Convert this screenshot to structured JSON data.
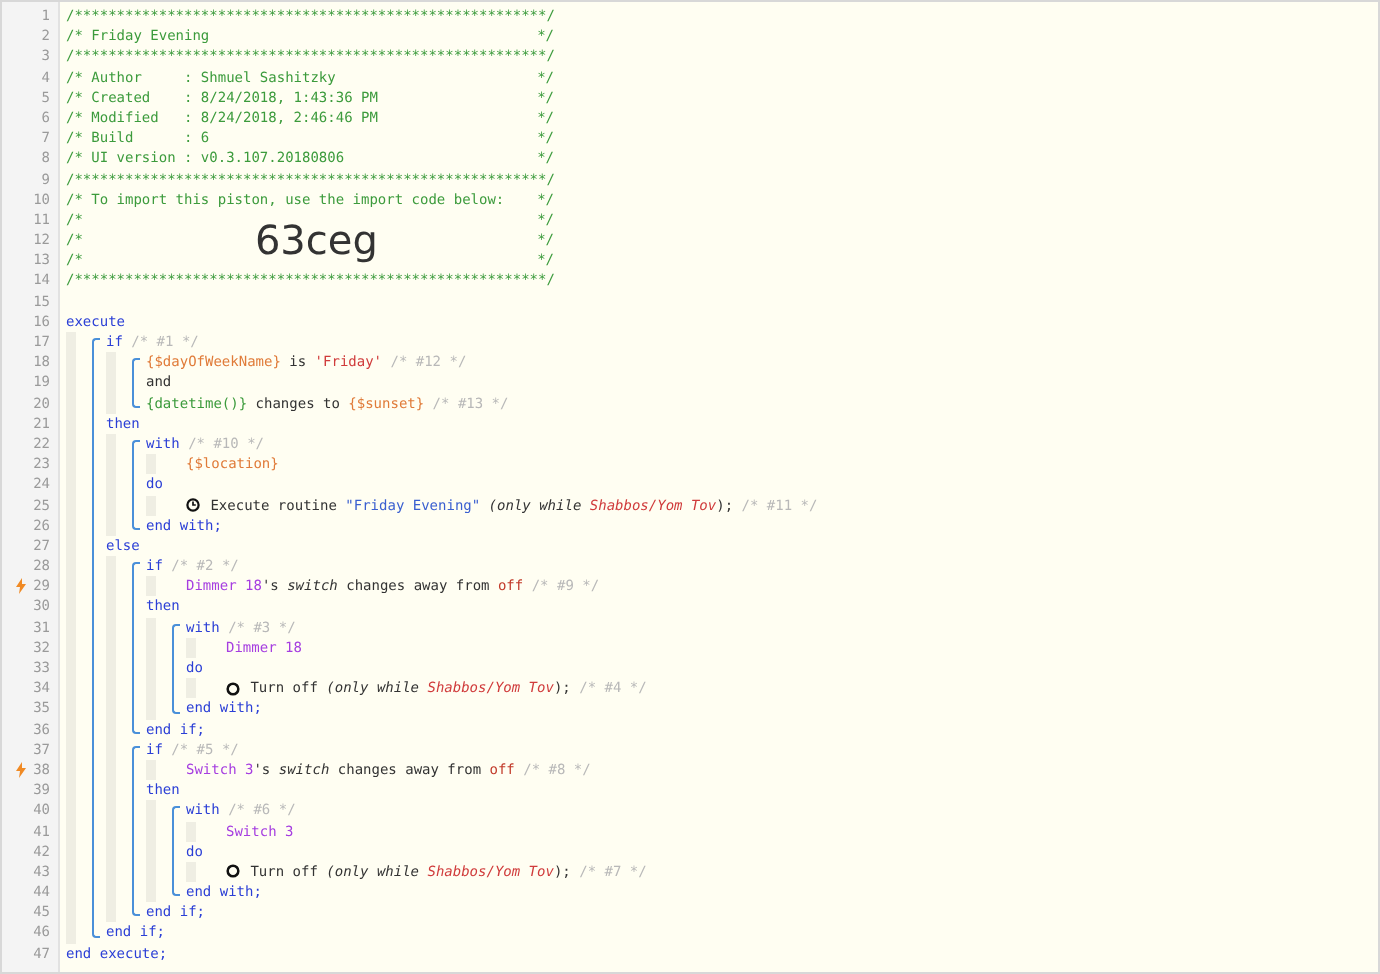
{
  "listing": [
    {
      "kind": "rule",
      "number": "1",
      "text": "/********************************************************/"
    },
    {
      "kind": "banner",
      "number": "2",
      "text": "/* Friday Evening",
      "end": "*/"
    },
    {
      "kind": "rule",
      "number": "3",
      "text": "/********************************************************/"
    },
    {
      "kind": "banner",
      "number": "4",
      "text": "/* Author     : Shmuel Sashitzky",
      "end": "*/"
    },
    {
      "kind": "banner",
      "number": "5",
      "text": "/* Created    : 8/24/2018, 1:43:36 PM",
      "end": "*/"
    },
    {
      "kind": "banner",
      "number": "6",
      "text": "/* Modified   : 8/24/2018, 2:46:46 PM",
      "end": "*/"
    },
    {
      "kind": "banner",
      "number": "7",
      "text": "/* Build      : 6",
      "end": "*/"
    },
    {
      "kind": "banner",
      "number": "8",
      "text": "/* UI version : v0.3.107.20180806",
      "end": "*/"
    },
    {
      "kind": "rule",
      "number": "9",
      "text": "/********************************************************/"
    },
    {
      "kind": "banner",
      "number": "10",
      "text": "/* To import this piston, use the import code below:",
      "end": "*/"
    },
    {
      "kind": "banner",
      "number": "11",
      "text": "/*",
      "end": "*/"
    },
    {
      "kind": "banner",
      "number": "12",
      "text": "/*",
      "end": "*/",
      "code": "63ceg"
    },
    {
      "kind": "banner",
      "number": "13",
      "text": "/*",
      "end": "*/"
    },
    {
      "kind": "rule",
      "number": "14",
      "text": "/********************************************************/"
    },
    {
      "kind": "blank",
      "number": "15"
    },
    {
      "kind": "code",
      "number": "16",
      "segments": [
        {
          "kind": "keyword",
          "text": "execute"
        }
      ],
      "children": [
        {
          "kind": "block",
          "children": [
            {
              "kind": "code",
              "number": "17",
              "segments": [
                {
                  "kind": "keyword",
                  "text": "if"
                },
                {
                  "kind": "note",
                  "text": " /* #1 */"
                }
              ],
              "children": [
                {
                  "kind": "block",
                  "children": [
                    {
                      "kind": "code",
                      "number": "18",
                      "segments": [
                        {
                          "kind": "variable",
                          "text": "{$dayOfWeekName}"
                        },
                        {
                          "kind": "text",
                          "text": " is "
                        },
                        {
                          "kind": "string",
                          "text": "'Friday'"
                        },
                        {
                          "kind": "note",
                          "text": " /* #12 */"
                        }
                      ]
                    },
                    {
                      "kind": "code",
                      "number": "19",
                      "segments": [
                        {
                          "kind": "text",
                          "text": "and"
                        }
                      ]
                    },
                    {
                      "kind": "code",
                      "number": "20",
                      "segments": [
                        {
                          "kind": "func",
                          "text": "{datetime()}"
                        },
                        {
                          "kind": "text",
                          "text": " changes to "
                        },
                        {
                          "kind": "variable",
                          "text": "{$sunset}"
                        },
                        {
                          "kind": "note",
                          "text": " /* #13 */"
                        }
                      ]
                    }
                  ]
                }
              ]
            },
            {
              "kind": "code",
              "number": "21",
              "segments": [
                {
                  "kind": "keyword",
                  "text": "then"
                }
              ],
              "children": [
                {
                  "kind": "block",
                  "children": [
                    {
                      "kind": "code",
                      "number": "22",
                      "segments": [
                        {
                          "kind": "keyword",
                          "text": "with"
                        },
                        {
                          "kind": "note",
                          "text": " /* #10 */"
                        }
                      ],
                      "children": [
                        {
                          "kind": "code",
                          "number": "23",
                          "segments": [
                            {
                              "kind": "variable",
                              "text": "{$location}"
                            }
                          ]
                        }
                      ]
                    },
                    {
                      "kind": "code",
                      "number": "24",
                      "segments": [
                        {
                          "kind": "keyword",
                          "text": "do"
                        }
                      ],
                      "children": [
                        {
                          "kind": "code",
                          "number": "25",
                          "segments": [
                            {
                              "kind": "clock"
                            },
                            {
                              "kind": "text",
                              "text": " Execute routine "
                            },
                            {
                              "kind": "literal",
                              "text": "\"Friday Evening\""
                            },
                            {
                              "kind": "italic",
                              "text": " (only while "
                            },
                            {
                              "kind": "condition",
                              "text": "Shabbos/Yom Tov"
                            },
                            {
                              "kind": "text",
                              "text": "); "
                            },
                            {
                              "kind": "note",
                              "text": "/* #11 */"
                            }
                          ]
                        }
                      ]
                    },
                    {
                      "kind": "code",
                      "number": "26",
                      "segments": [
                        {
                          "kind": "keyword",
                          "text": "end with;"
                        }
                      ]
                    }
                  ]
                }
              ]
            },
            {
              "kind": "code",
              "number": "27",
              "segments": [
                {
                  "kind": "keyword",
                  "text": "else"
                }
              ],
              "children": [
                {
                  "kind": "block",
                  "children": [
                    {
                      "kind": "code",
                      "number": "28",
                      "segments": [
                        {
                          "kind": "keyword",
                          "text": "if"
                        },
                        {
                          "kind": "note",
                          "text": " /* #2 */"
                        }
                      ],
                      "children": [
                        {
                          "kind": "code",
                          "number": "29",
                          "trigger": true,
                          "segments": [
                            {
                              "kind": "device",
                              "text": "Dimmer 18"
                            },
                            {
                              "kind": "text",
                              "text": "'s "
                            },
                            {
                              "kind": "italic",
                              "text": "switch"
                            },
                            {
                              "kind": "text",
                              "text": " changes away from "
                            },
                            {
                              "kind": "value",
                              "text": "off"
                            },
                            {
                              "kind": "note",
                              "text": " /* #9 */"
                            }
                          ]
                        }
                      ]
                    },
                    {
                      "kind": "code",
                      "number": "30",
                      "segments": [
                        {
                          "kind": "keyword",
                          "text": "then"
                        }
                      ],
                      "children": [
                        {
                          "kind": "block",
                          "children": [
                            {
                              "kind": "code",
                              "number": "31",
                              "segments": [
                                {
                                  "kind": "keyword",
                                  "text": "with"
                                },
                                {
                                  "kind": "note",
                                  "text": " /* #3 */"
                                }
                              ],
                              "children": [
                                {
                                  "kind": "code",
                                  "number": "32",
                                  "segments": [
                                    {
                                      "kind": "device",
                                      "text": "Dimmer 18"
                                    }
                                  ]
                                }
                              ]
                            },
                            {
                              "kind": "code",
                              "number": "33",
                              "segments": [
                                {
                                  "kind": "keyword",
                                  "text": "do"
                                }
                              ],
                              "children": [
                                {
                                  "kind": "code",
                                  "number": "34",
                                  "segments": [
                                    {
                                      "kind": "ring"
                                    },
                                    {
                                      "kind": "text",
                                      "text": " Turn off "
                                    },
                                    {
                                      "kind": "italic",
                                      "text": "(only while "
                                    },
                                    {
                                      "kind": "condition",
                                      "text": "Shabbos/Yom Tov"
                                    },
                                    {
                                      "kind": "text",
                                      "text": "); "
                                    },
                                    {
                                      "kind": "note",
                                      "text": "/* #4 */"
                                    }
                                  ]
                                }
                              ]
                            },
                            {
                              "kind": "code",
                              "number": "35",
                              "segments": [
                                {
                                  "kind": "keyword",
                                  "text": "end with;"
                                }
                              ]
                            }
                          ]
                        }
                      ]
                    },
                    {
                      "kind": "code",
                      "number": "36",
                      "segments": [
                        {
                          "kind": "keyword",
                          "text": "end if;"
                        }
                      ]
                    }
                  ]
                },
                {
                  "kind": "block",
                  "children": [
                    {
                      "kind": "code",
                      "number": "37",
                      "segments": [
                        {
                          "kind": "keyword",
                          "text": "if"
                        },
                        {
                          "kind": "note",
                          "text": " /* #5 */"
                        }
                      ],
                      "children": [
                        {
                          "kind": "code",
                          "number": "38",
                          "trigger": true,
                          "segments": [
                            {
                              "kind": "device",
                              "text": "Switch 3"
                            },
                            {
                              "kind": "text",
                              "text": "'s "
                            },
                            {
                              "kind": "italic",
                              "text": "switch"
                            },
                            {
                              "kind": "text",
                              "text": " changes away from "
                            },
                            {
                              "kind": "value",
                              "text": "off"
                            },
                            {
                              "kind": "note",
                              "text": " /* #8 */"
                            }
                          ]
                        }
                      ]
                    },
                    {
                      "kind": "code",
                      "number": "39",
                      "segments": [
                        {
                          "kind": "keyword",
                          "text": "then"
                        }
                      ],
                      "children": [
                        {
                          "kind": "block",
                          "children": [
                            {
                              "kind": "code",
                              "number": "40",
                              "segments": [
                                {
                                  "kind": "keyword",
                                  "text": "with"
                                },
                                {
                                  "kind": "note",
                                  "text": " /* #6 */"
                                }
                              ],
                              "children": [
                                {
                                  "kind": "code",
                                  "number": "41",
                                  "segments": [
                                    {
                                      "kind": "device",
                                      "text": "Switch 3"
                                    }
                                  ]
                                }
                              ]
                            },
                            {
                              "kind": "code",
                              "number": "42",
                              "segments": [
                                {
                                  "kind": "keyword",
                                  "text": "do"
                                }
                              ],
                              "children": [
                                {
                                  "kind": "code",
                                  "number": "43",
                                  "segments": [
                                    {
                                      "kind": "ring"
                                    },
                                    {
                                      "kind": "text",
                                      "text": " Turn off "
                                    },
                                    {
                                      "kind": "italic",
                                      "text": "(only while "
                                    },
                                    {
                                      "kind": "condition",
                                      "text": "Shabbos/Yom Tov"
                                    },
                                    {
                                      "kind": "text",
                                      "text": "); "
                                    },
                                    {
                                      "kind": "note",
                                      "text": "/* #7 */"
                                    }
                                  ]
                                }
                              ]
                            },
                            {
                              "kind": "code",
                              "number": "44",
                              "segments": [
                                {
                                  "kind": "keyword",
                                  "text": "end with;"
                                }
                              ]
                            }
                          ]
                        }
                      ]
                    },
                    {
                      "kind": "code",
                      "number": "45",
                      "segments": [
                        {
                          "kind": "keyword",
                          "text": "end if;"
                        }
                      ]
                    }
                  ]
                }
              ]
            },
            {
              "kind": "code",
              "number": "46",
              "segments": [
                {
                  "kind": "keyword",
                  "text": "end if;"
                }
              ]
            }
          ]
        }
      ]
    },
    {
      "kind": "code",
      "number": "47",
      "segments": [
        {
          "kind": "keyword",
          "text": "end execute;"
        }
      ]
    }
  ]
}
